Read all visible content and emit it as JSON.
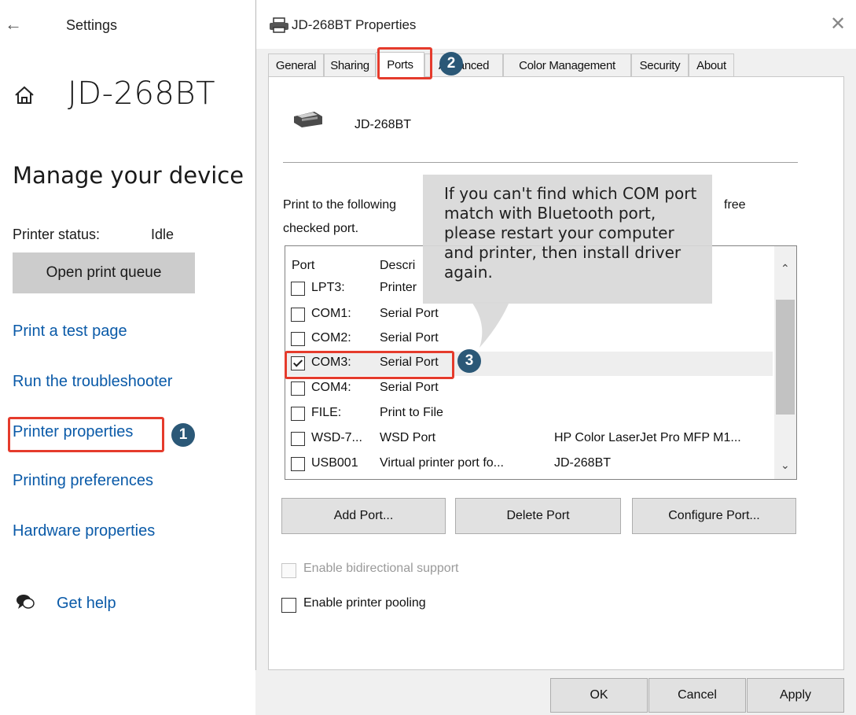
{
  "settings": {
    "back_icon": "back-arrow-icon",
    "title": "Settings",
    "home_icon": "home-icon",
    "device_name": "JD-268BT",
    "section_heading": "Manage your device",
    "printer_status_label": "Printer status:",
    "printer_status_value": "Idle",
    "open_queue_label": "Open print queue",
    "links": [
      "Print a test page",
      "Run the troubleshooter",
      "Printer properties",
      "Printing preferences",
      "Hardware properties"
    ],
    "help_icon": "chat-help-icon",
    "help_label": "Get help"
  },
  "dialog": {
    "title": "JD-268BT Properties",
    "title_icon": "printer-icon",
    "close_icon": "close-icon",
    "tabs": [
      "General",
      "Sharing",
      "Ports",
      "Advanced",
      "Color Management",
      "Security",
      "About"
    ],
    "active_tab": "Ports",
    "printer_name": "JD-268BT",
    "instruction_line1": "Print to the following",
    "instruction_right": "free",
    "instruction_line2": "checked port.",
    "columns": {
      "port": "Port",
      "description": "Descri"
    },
    "ports": [
      {
        "port": "LPT3:",
        "description": "Printer",
        "printer": "",
        "checked": false
      },
      {
        "port": "COM1:",
        "description": "Serial Port",
        "printer": "",
        "checked": false
      },
      {
        "port": "COM2:",
        "description": "Serial Port",
        "printer": "",
        "checked": false
      },
      {
        "port": "COM3:",
        "description": "Serial Port",
        "printer": "",
        "checked": true
      },
      {
        "port": "COM4:",
        "description": "Serial Port",
        "printer": "",
        "checked": false
      },
      {
        "port": "FILE:",
        "description": "Print to File",
        "printer": "",
        "checked": false
      },
      {
        "port": "WSD-7...",
        "description": "WSD Port",
        "printer": "HP Color LaserJet Pro MFP M1...",
        "checked": false
      },
      {
        "port": "USB001",
        "description": "Virtual printer port fo...",
        "printer": "JD-268BT",
        "checked": false
      }
    ],
    "buttons": {
      "add_port": "Add Port...",
      "delete_port": "Delete Port",
      "configure_port": "Configure Port..."
    },
    "enable_bidirectional": "Enable bidirectional support",
    "enable_pooling": "Enable printer pooling",
    "footer": {
      "ok": "OK",
      "cancel": "Cancel",
      "apply": "Apply"
    }
  },
  "callout_text": "If you can't find which COM port match with Bluetooth port, please restart your computer and printer, then install driver again.",
  "step_badges": [
    "1",
    "2",
    "3"
  ],
  "colors": {
    "highlight_red": "#e53b2c",
    "badge_blue": "#2b5877",
    "link_blue": "#0a5aa8",
    "dialog_gray": "#f0f0f0"
  }
}
